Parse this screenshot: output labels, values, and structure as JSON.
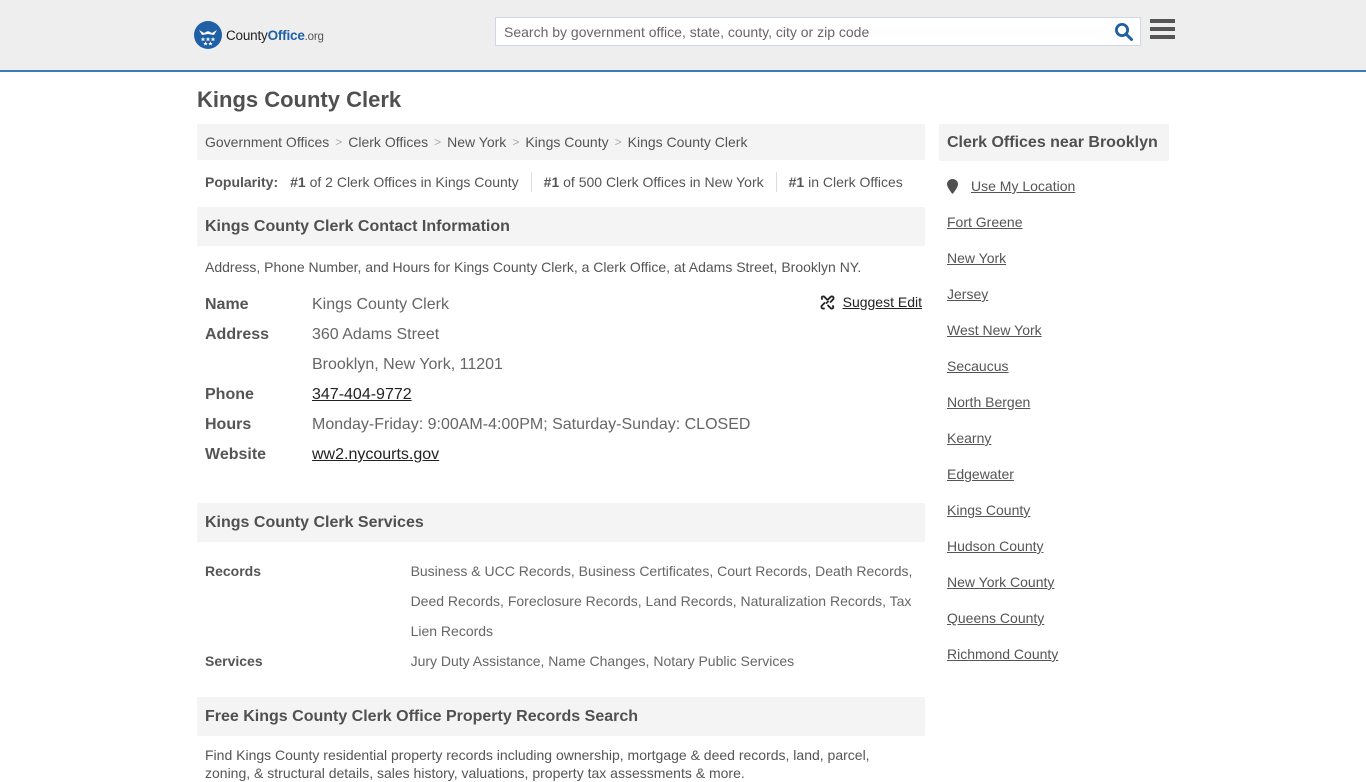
{
  "header": {
    "logo": {
      "county": "County",
      "office": "Office",
      "org": ".org"
    },
    "search_placeholder": "Search by government office, state, county, city or zip code",
    "search_icon": "search-icon",
    "menu_icon": "hamburger-menu-icon",
    "colors": {
      "brand_blue": "#1f5fa6",
      "accent_line": "#3a7cb8"
    }
  },
  "page": {
    "title": "Kings County Clerk"
  },
  "breadcrumb": [
    {
      "label": "Government Offices"
    },
    {
      "label": "Clerk Offices"
    },
    {
      "label": "New York"
    },
    {
      "label": "Kings County"
    },
    {
      "label": "Kings County Clerk"
    }
  ],
  "popularity": {
    "label": "Popularity:",
    "items": [
      {
        "rank": "#1",
        "text": " of 2 Clerk Offices in Kings County"
      },
      {
        "rank": "#1",
        "text": " of 500 Clerk Offices in New York"
      },
      {
        "rank": "#1",
        "text": " in Clerk Offices"
      }
    ]
  },
  "contact": {
    "heading": "Kings County Clerk Contact Information",
    "description": "Address, Phone Number, and Hours for Kings County Clerk, a Clerk Office, at Adams Street, Brooklyn NY.",
    "suggest_edit": "Suggest Edit",
    "suggest_icon": "unlink-icon",
    "name_label": "Name",
    "name_value": "Kings County Clerk",
    "address_label": "Address",
    "address_line1": "360 Adams Street",
    "address_line2": "Brooklyn, New York, 11201",
    "phone_label": "Phone",
    "phone_value": "347-404-9772",
    "hours_label": "Hours",
    "hours_value": "Monday-Friday: 9:00AM-4:00PM; Saturday-Sunday: CLOSED",
    "website_label": "Website",
    "website_value": "ww2.nycourts.gov"
  },
  "services": {
    "heading": "Kings County Clerk Services",
    "rows": [
      {
        "label": "Records",
        "value": "Business & UCC Records, Business Certificates, Court Records, Death Records, Deed Records, Foreclosure Records, Land Records, Naturalization Records, Tax Lien Records"
      },
      {
        "label": "Services",
        "value": "Jury Duty Assistance, Name Changes, Notary Public Services"
      }
    ]
  },
  "property": {
    "heading": "Free Kings County Clerk Office Property Records Search",
    "description": "Find Kings County residential property records including ownership, mortgage & deed records, land, parcel, zoning, & structural details, sales history, valuations, property tax assessments & more."
  },
  "sidebar": {
    "heading": "Clerk Offices near Brooklyn",
    "use_location": "Use My Location",
    "location_icon": "map-pin-icon",
    "links": [
      "Fort Greene",
      "New York",
      "Jersey",
      "West New York",
      "Secaucus",
      "North Bergen",
      "Kearny",
      "Edgewater",
      "Kings County",
      "Hudson County",
      "New York County",
      "Queens County",
      "Richmond County"
    ]
  }
}
